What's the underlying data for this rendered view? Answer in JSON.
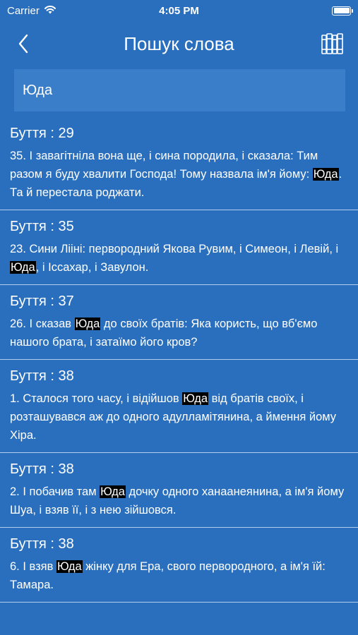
{
  "status_bar": {
    "carrier": "Carrier",
    "time": "4:05 PM"
  },
  "nav": {
    "title": "Пошук слова"
  },
  "search": {
    "value": "Юда"
  },
  "results": [
    {
      "ref": "Буття : 29",
      "before": "35. І завагітніла вона ще, і сина породила, і сказала: Тим разом я буду хвалити Господа! Тому назвала ім'я йому: ",
      "match": "Юда",
      "after": ". Та й перестала роджати."
    },
    {
      "ref": "Буття : 35",
      "before": "23. Сини Лііні: первородний Якова Рувим, і Симеон, і Левій, і ",
      "match": "Юда",
      "after": ", і Іссахар, і Завулон."
    },
    {
      "ref": "Буття : 37",
      "before": "26. І сказав ",
      "match": "Юда",
      "after": " до своїх братів: Яка користь, що вб'ємо нашого брата, і затаїмо його кров?"
    },
    {
      "ref": "Буття : 38",
      "before": "1. Сталося того часу, і відійшов ",
      "match": "Юда",
      "after": " від братів своїх, і розташувався аж до одного адулламітянина, а ймення йому Хіра."
    },
    {
      "ref": "Буття : 38",
      "before": "2. І побачив там ",
      "match": "Юда",
      "after": " дочку одного ханаанеянина, а ім'я йому Шуа, і взяв її, і з нею зійшовся."
    },
    {
      "ref": "Буття : 38",
      "before": "6. І взяв ",
      "match": "Юда",
      "after": " жінку для Ера, свого первородного, а ім'я їй: Тамара."
    }
  ]
}
